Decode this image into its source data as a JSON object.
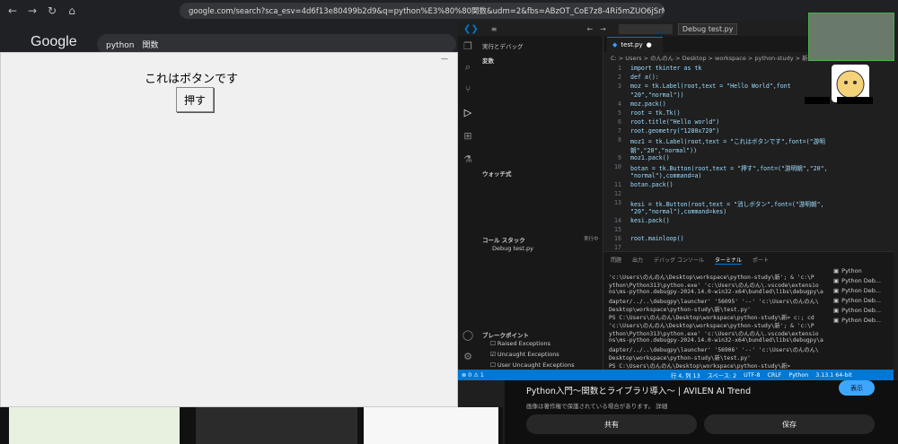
{
  "browser": {
    "url": "google.com/search?sca_esv=4d6f13e80499b2d9&q=python%E3%80%80関数&udm=2&fbs=ABzOT_CoE7z8-4Ri5mZUO6jSrMwyrNG4U34ga0I73HFD..."
  },
  "google": {
    "logo": "Google",
    "query": "python　関数"
  },
  "tk_app": {
    "label": "これはボタンです",
    "button": "押す"
  },
  "vscode": {
    "sidebar_title": "実行とデバッグ",
    "sections": {
      "variables": "変数",
      "watch": "ウォッチ式",
      "callstack": "コール スタック",
      "callstack_item": "Debug test.py",
      "callstack_status": "実行中",
      "breakpoints": "ブレークポイント"
    },
    "breakpoints": [
      {
        "label": "Raised Exceptions",
        "checked": false
      },
      {
        "label": "Uncaught Exceptions",
        "checked": true
      },
      {
        "label": "User Uncaught Exceptions",
        "checked": false
      }
    ],
    "debug_config": "Debug test.py",
    "tab": "test.py",
    "breadcrumb": "C: > Users > のんのん > Desktop > workspace > python-study > 新 > ...",
    "code": [
      {
        "n": "1",
        "t": "import tkinter as tk"
      },
      {
        "n": "2",
        "t": "def a():"
      },
      {
        "n": "3",
        "t": "    moz = tk.Label(root,text = \"Hello World\",font"
      },
      {
        "n": "",
        "t": "    \"20\",\"normal\"))"
      },
      {
        "n": "4",
        "t": "    moz.pack()"
      },
      {
        "n": "5",
        "t": "root = tk.Tk()"
      },
      {
        "n": "6",
        "t": "root.title(\"Hello world\")"
      },
      {
        "n": "7",
        "t": "root.geometry(\"1280x720\")"
      },
      {
        "n": "8",
        "t": "moz1 = tk.Label(root,text = \"これはボタンです\",font=(\"游明"
      },
      {
        "n": "",
        "t": "朝\",\"20\",\"normal\"))"
      },
      {
        "n": "9",
        "t": "moz1.pack()"
      },
      {
        "n": "10",
        "t": "botan = tk.Button(root,text = \"押す\",font=(\"游明朝\",\"20\","
      },
      {
        "n": "",
        "t": "\"normal\"),command=a)"
      },
      {
        "n": "11",
        "t": "botan.pack()"
      },
      {
        "n": "12",
        "t": ""
      },
      {
        "n": "13",
        "t": "kesi = tk.Button(root,text = \"消しボタン\",font=(\"游明朝\","
      },
      {
        "n": "",
        "t": "\"20\",\"normal\"),command=kes)"
      },
      {
        "n": "14",
        "t": "kesi.pack()"
      },
      {
        "n": "15",
        "t": ""
      },
      {
        "n": "16",
        "t": "root.mainloop()"
      },
      {
        "n": "17",
        "t": ""
      }
    ],
    "panel_tabs": [
      "問題",
      "出力",
      "デバッグ コンソール",
      "ターミナル",
      "ポート"
    ],
    "problems_count": "1",
    "terminal": [
      "'c:\\Users\\のんのん\\Desktop\\workspace\\python-study\\新'; & 'c:\\P",
      "ython\\Python313\\python.exe' 'c:\\Users\\のんのん\\.vscode\\extensio",
      "ns\\ms-python.debugpy-2024.14.0-win32-x64\\bundled\\libs\\debugpy\\a",
      "dapter/../..\\debugpy\\launcher' '56095' '--' 'c:\\Users\\のんのん\\",
      "Desktop\\workspace\\python-study\\新\\test.py'",
      "PS C:\\Users\\のんのん\\Desktop\\workspace\\python-study\\新> c:; cd",
      "'c:\\Users\\のんのん\\Desktop\\workspace\\python-study\\新'; & 'c:\\P",
      "ython\\Python313\\python.exe' 'c:\\Users\\のんのん\\.vscode\\extensio",
      "ns\\ms-python.debugpy-2024.14.0-win32-x64\\bundled\\libs\\debugpy\\a",
      "dapter/../..\\debugpy\\launcher' '56906' '--' 'c:\\Users\\のんのん\\",
      "Desktop\\workspace\\python-study\\新\\test.py'",
      "PS C:\\Users\\のんのん\\Desktop\\workspace\\python-study\\新>"
    ],
    "terminal_list": [
      "Python",
      "Python Deb...",
      "Python Deb...",
      "Python Deb...",
      "Python Deb...",
      "Python Deb..."
    ],
    "status": {
      "errors": "⊗ 0 ⚠ 1",
      "position": "行 4, 列 13",
      "spaces": "スペース: 2",
      "encoding": "UTF-8",
      "eol": "CRLF",
      "lang": "Python",
      "version": "3.13.1 64-bit"
    }
  },
  "youtube": {
    "title": "Python入門〜関数とライブラリ導入〜 | AVILEN AI Trend",
    "show": "表示",
    "subtitle": "画像は著作権で保護されている場合があります。 詳細",
    "share": "共有",
    "save": "保存"
  },
  "colors": {
    "accent": "#0078d4",
    "tk_bg": "#f0f0f0"
  }
}
